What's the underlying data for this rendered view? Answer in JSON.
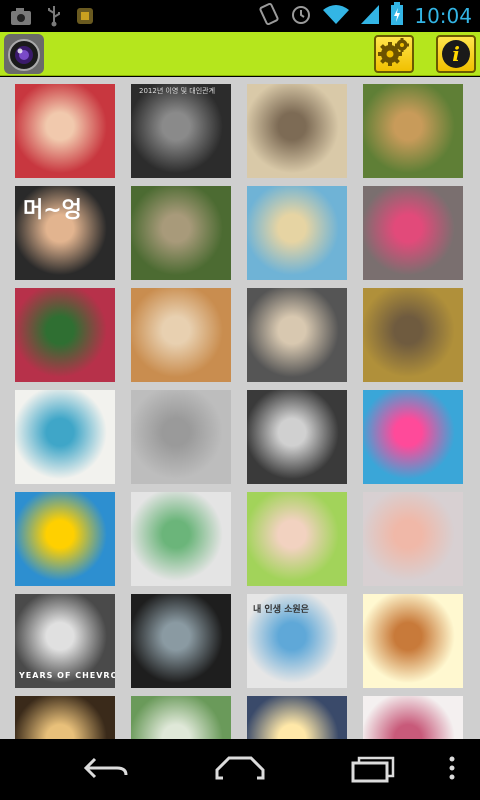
{
  "status_bar": {
    "time": "10:04",
    "colors": {
      "accent": "#33b5e5"
    },
    "icons": [
      "camera-notification-icon",
      "usb-icon",
      "app-notification-icon",
      "rotation-lock-icon",
      "alarm-icon",
      "wifi-icon",
      "signal-icon",
      "battery-charging-icon"
    ]
  },
  "app_bar": {
    "background": "#b5e61d",
    "logo_icon": "camera-lens-icon",
    "actions": [
      {
        "name": "settings",
        "icon": "gear-icon"
      },
      {
        "name": "info",
        "icon": "info-icon",
        "glyph": "i"
      }
    ]
  },
  "gallery": {
    "thumbnails": [
      {
        "name": "photo-baby-red-hood",
        "bg": "#c8373f",
        "accent": "#f1c9ad"
      },
      {
        "name": "photo-korean-document",
        "bg": "#2c2c2c",
        "accent": "#8a8a8a",
        "caption": "2012년 이영 및 대인관계"
      },
      {
        "name": "photo-kitten",
        "bg": "#d9c9a8",
        "accent": "#7d6b55"
      },
      {
        "name": "photo-deer-meadow",
        "bg": "#5f7f36",
        "accent": "#c89b5a"
      },
      {
        "name": "photo-portrait-text",
        "bg": "#2a2a2a",
        "accent": "#e2b48f",
        "caption": "머~엉"
      },
      {
        "name": "photo-garden-stairs",
        "bg": "#4c6b32",
        "accent": "#a89a7a"
      },
      {
        "name": "photo-beach-figure",
        "bg": "#6fb3d6",
        "accent": "#e6d4a3"
      },
      {
        "name": "photo-car-petals",
        "bg": "#7a6f6f",
        "accent": "#e24a7a"
      },
      {
        "name": "photo-red-blossoms",
        "bg": "#b7314a",
        "accent": "#2f6f32"
      },
      {
        "name": "photo-golden-puppy",
        "bg": "#c98d4f",
        "accent": "#e8d0b0"
      },
      {
        "name": "photo-rock-cave-toy",
        "bg": "#555555",
        "accent": "#d8c8b0"
      },
      {
        "name": "photo-autumn-path",
        "bg": "#b0903a",
        "accent": "#6f5b3f"
      },
      {
        "name": "photo-baby-walker",
        "bg": "#f2f2ee",
        "accent": "#3fa6c8"
      },
      {
        "name": "photo-foggy-field",
        "bg": "#bdbdbd",
        "accent": "#9a9a9a"
      },
      {
        "name": "photo-black-car",
        "bg": "#3a3a3a",
        "accent": "#d0d0d0"
      },
      {
        "name": "photo-pink-cosmos",
        "bg": "#3aa6d8",
        "accent": "#ff4a9a"
      },
      {
        "name": "photo-colorful-art",
        "bg": "#2d8fd0",
        "accent": "#ffd000"
      },
      {
        "name": "photo-knit-mitten",
        "bg": "#e4e4e4",
        "accent": "#6bb57a"
      },
      {
        "name": "photo-baby-frame-bear",
        "bg": "#a2d35a",
        "accent": "#f2d2c0"
      },
      {
        "name": "photo-newborn-baby",
        "bg": "#d8d0d2",
        "accent": "#f0b8a8"
      },
      {
        "name": "photo-chevrolet-100",
        "bg": "#4a4a4a",
        "accent": "#e0e0e0",
        "caption": "YEARS OF CHEVROLET"
      },
      {
        "name": "photo-dark-window-room",
        "bg": "#1e1e1e",
        "accent": "#8a9aa2"
      },
      {
        "name": "photo-cartoon-sleeping",
        "bg": "#e6e6e6",
        "accent": "#5fa8d8",
        "caption": "내 인생 소원은"
      },
      {
        "name": "photo-rilakkuma",
        "bg": "#fff8d0",
        "accent": "#c87a3a"
      },
      {
        "name": "photo-night-lights",
        "bg": "#3a2a1a",
        "accent": "#e8c07a"
      },
      {
        "name": "photo-handwriting-field",
        "bg": "#6a9a5a",
        "accent": "#dfe8d8"
      },
      {
        "name": "photo-sunset-sky",
        "bg": "#3a4a6a",
        "accent": "#ffe8a8"
      },
      {
        "name": "photo-floral-pattern",
        "bg": "#f4f0f0",
        "accent": "#c85a7a"
      }
    ]
  },
  "nav_bar": {
    "buttons": [
      {
        "name": "back",
        "icon": "back-arrow-icon"
      },
      {
        "name": "home",
        "icon": "home-icon"
      },
      {
        "name": "recents",
        "icon": "recent-apps-icon"
      },
      {
        "name": "menu",
        "icon": "overflow-menu-icon"
      }
    ]
  }
}
